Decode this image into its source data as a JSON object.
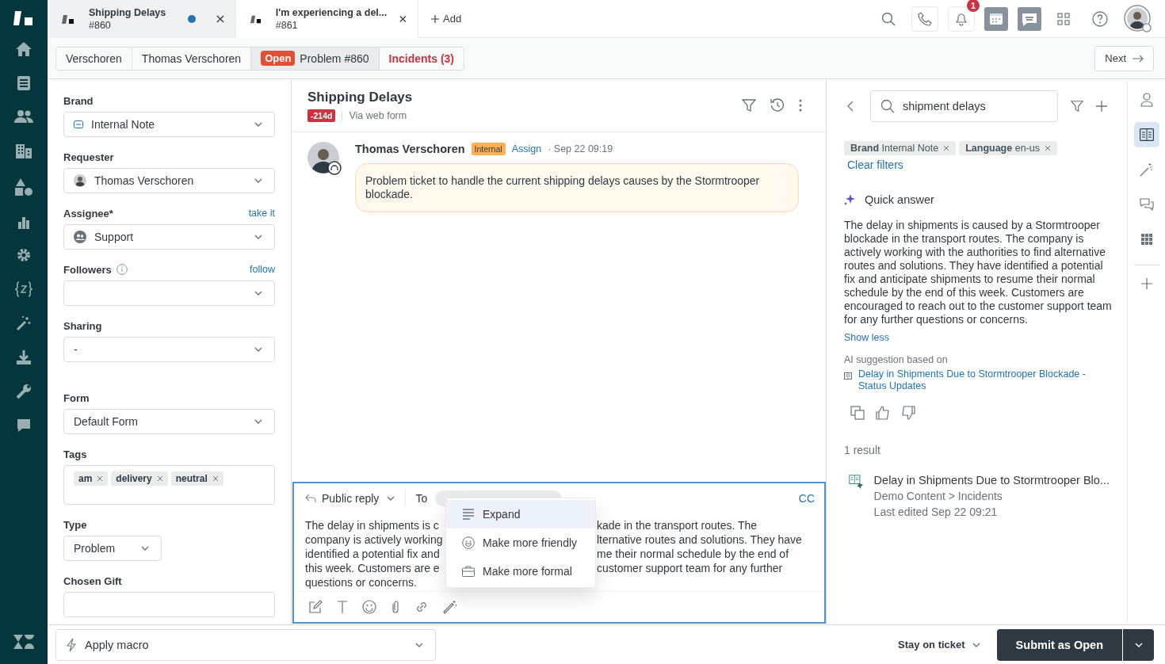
{
  "tabs": [
    {
      "title": "Shipping Delays",
      "subtitle": "#860",
      "selected": true,
      "unsaved": true
    },
    {
      "title": "I'm experiencing a del...",
      "subtitle": "#861",
      "selected": false,
      "unsaved": false
    }
  ],
  "add_tab": "Add",
  "notification_count": "1",
  "breadcrumbs": [
    {
      "label": "Verschoren",
      "kind": "plain",
      "selected": false
    },
    {
      "label": "Thomas Verschoren",
      "kind": "plain",
      "selected": false
    },
    {
      "label": "Problem #860",
      "status": "Open",
      "kind": "ticket",
      "selected": true
    },
    {
      "label": "Incidents (3)",
      "kind": "alert",
      "selected": false
    }
  ],
  "next": "Next",
  "fields": [
    {
      "label": "Brand",
      "kind": "brand-select",
      "value": "Internal Note"
    },
    {
      "label": "Requester",
      "kind": "user-select",
      "value": "Thomas Verschoren"
    },
    {
      "label": "Assignee*",
      "action": "take it",
      "kind": "group-select",
      "value": "Support"
    },
    {
      "label": "Followers",
      "info": true,
      "action": "follow",
      "kind": "select"
    },
    {
      "label": "Sharing",
      "kind": "select",
      "value": "-"
    },
    {
      "label": "Form",
      "kind": "select",
      "value": "Default Form",
      "divider": true
    },
    {
      "label": "Tags",
      "kind": "tags",
      "tags": [
        "am",
        "delivery",
        "neutral"
      ]
    },
    {
      "label": "Type",
      "kind": "short-select",
      "value": "Problem"
    },
    {
      "label": "Chosen Gift",
      "kind": "text"
    }
  ],
  "ticket": {
    "title": "Shipping Delays",
    "sla": "-214d",
    "via": "Via web form"
  },
  "comment": {
    "author": "Thomas Verschoren",
    "badge": "Internal",
    "assign": "Assign",
    "time": "· Sep 22 09:19",
    "body": "Problem ticket to handle the current shipping delays causes by the Stormtrooper blockade."
  },
  "reply": {
    "mode": "Public reply",
    "to": "To",
    "cc": "CC",
    "lines": [
      {
        "left": "The delay in shipments is c",
        "right": "kade in the transport routes. The"
      },
      {
        "left": "company is actively working",
        "right": "lternative routes and solutions. They have"
      },
      {
        "left": "identified a potential fix and",
        "right": "me their normal schedule by the end of"
      },
      {
        "left": "this week. Customers are e",
        "right": "customer support team for any further"
      },
      {
        "left": "questions or concerns."
      }
    ],
    "menu": [
      {
        "label": "Expand",
        "kind": "expand",
        "selected": true
      },
      {
        "label": "Make more friendly",
        "kind": "friendly",
        "selected": false
      },
      {
        "label": "Make more formal",
        "kind": "formal",
        "selected": false
      }
    ]
  },
  "macro": "Apply macro",
  "stay": "Stay on ticket",
  "submit": "Submit as Open",
  "knowledge": {
    "search": "shipment delays",
    "filters": [
      {
        "key": "Brand",
        "value": "Internal Note"
      },
      {
        "key": "Language",
        "value": "en-us"
      }
    ],
    "clear": "Clear filters",
    "quick_title": "Quick answer",
    "answer": "The delay in shipments is caused by a Stormtrooper blockade in the transport routes. The company is actively working with the authorities to find alternative routes and solutions. They have identified a potential fix and anticipate shipments to resume their normal schedule by the end of this week. Customers are encouraged to reach out to the customer support team for any further questions or concerns.",
    "show_less": "Show less",
    "ai_label": "AI suggestion based on",
    "source": "Delay in Shipments Due to Stormtrooper Blockade - Status Updates",
    "result_count": "1 result",
    "results": [
      {
        "title": "Delay in Shipments Due to Stormtrooper Blo...",
        "path": "Demo Content > Incidents",
        "edited": "Last edited Sep 22 09:21"
      }
    ]
  },
  "rail": [
    {
      "kind": "user",
      "selected": false
    },
    {
      "kind": "book",
      "selected": true
    },
    {
      "kind": "wand",
      "selected": false
    },
    {
      "kind": "chat",
      "selected": false
    },
    {
      "kind": "apps",
      "selected": false
    }
  ]
}
